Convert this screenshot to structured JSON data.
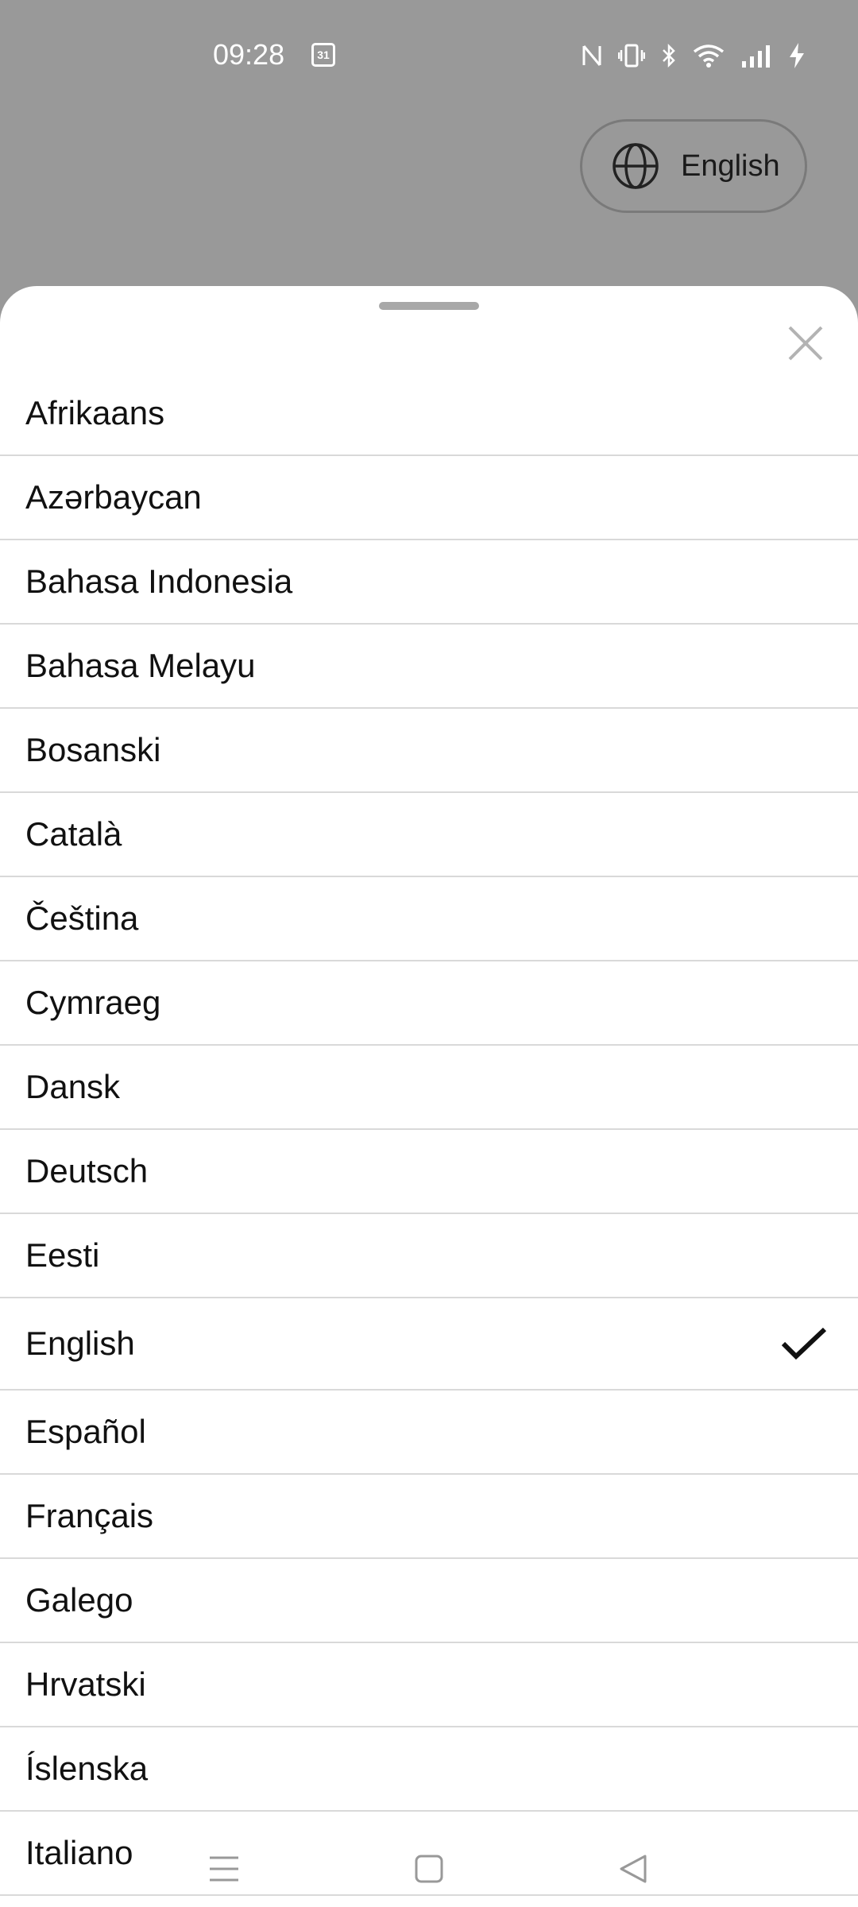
{
  "status_bar": {
    "time": "09:28",
    "calendar_day": "31",
    "icons": [
      "nfc-icon",
      "vibrate-icon",
      "bluetooth-icon",
      "wifi-icon",
      "signal-icon",
      "charging-icon"
    ]
  },
  "language_button": {
    "label": "English",
    "icon": "globe-icon"
  },
  "sheet": {
    "close_icon": "close-icon",
    "languages": [
      {
        "label": "Afrikaans",
        "selected": false
      },
      {
        "label": "Azərbaycan",
        "selected": false
      },
      {
        "label": "Bahasa Indonesia",
        "selected": false
      },
      {
        "label": "Bahasa Melayu",
        "selected": false
      },
      {
        "label": "Bosanski",
        "selected": false
      },
      {
        "label": "Català",
        "selected": false
      },
      {
        "label": "Čeština",
        "selected": false
      },
      {
        "label": "Cymraeg",
        "selected": false
      },
      {
        "label": "Dansk",
        "selected": false
      },
      {
        "label": "Deutsch",
        "selected": false
      },
      {
        "label": "Eesti",
        "selected": false
      },
      {
        "label": "English",
        "selected": true
      },
      {
        "label": "Español",
        "selected": false
      },
      {
        "label": "Français",
        "selected": false
      },
      {
        "label": "Galego",
        "selected": false
      },
      {
        "label": "Hrvatski",
        "selected": false
      },
      {
        "label": "Íslenska",
        "selected": false
      },
      {
        "label": "Italiano",
        "selected": false
      }
    ]
  },
  "nav_bar": {
    "buttons": [
      "menu-icon",
      "home-icon",
      "back-icon"
    ]
  }
}
